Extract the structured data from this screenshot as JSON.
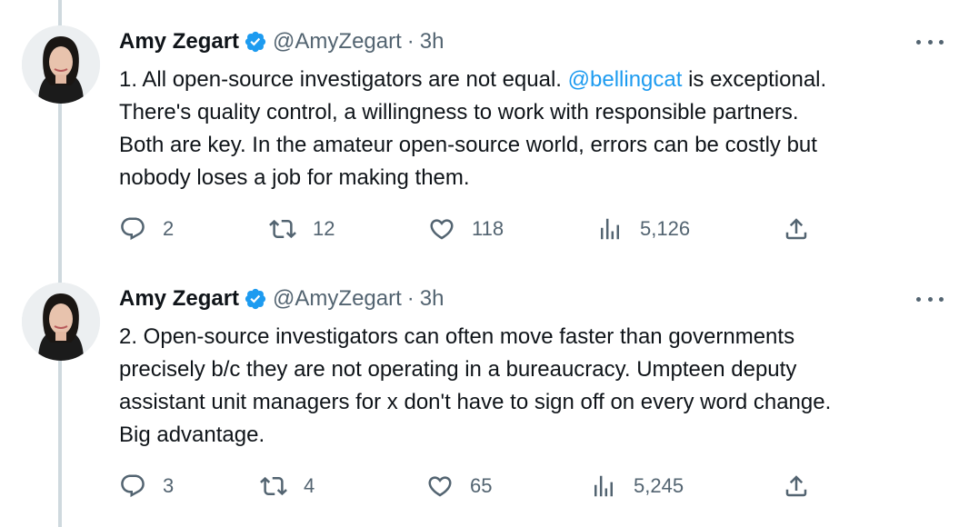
{
  "tweets": [
    {
      "author_name": "Amy Zegart",
      "handle": "@AmyZegart",
      "separator": "·",
      "time": "3h",
      "lines": [
        "1. All open-source investigators are not equal. ",
        "There's quality control, a willingness to work with responsible partners.",
        "Both are key. In the amateur open-source world, errors can be costly but",
        "nobody loses a job for making them."
      ],
      "mention": "@bellingcat",
      "line1_after_mention": " is exceptional.",
      "replies": "2",
      "retweets": "12",
      "likes": "118",
      "views": "5,126"
    },
    {
      "author_name": "Amy Zegart",
      "handle": "@AmyZegart",
      "separator": "·",
      "time": "3h",
      "lines": [
        "2. Open-source investigators can often move faster than governments",
        "precisely b/c they are not operating in a bureaucracy. Umpteen deputy",
        "assistant unit managers for x don't have to sign off on every word change.",
        "Big advantage."
      ],
      "replies": "3",
      "retweets": "4",
      "likes": "65",
      "views": "5,245"
    }
  ],
  "icons": {
    "verified": "verified-badge-icon",
    "more": "more-horizontal-icon",
    "reply": "reply-icon",
    "retweet": "retweet-icon",
    "like": "heart-icon",
    "views": "views-chart-icon",
    "share": "share-icon"
  },
  "colors": {
    "accent": "#1d9bf0",
    "secondary_text": "#536471",
    "thread_line": "#cfd9de"
  }
}
